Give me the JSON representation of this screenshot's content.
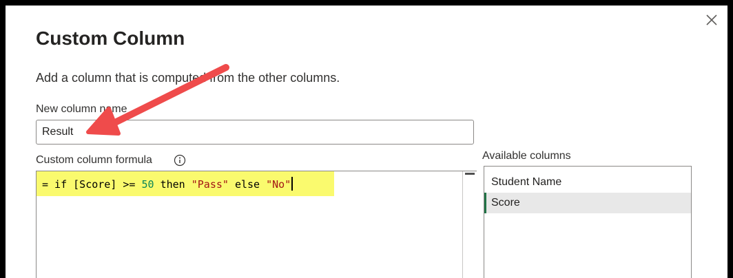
{
  "dialog": {
    "title": "Custom Column",
    "description": "Add a column that is computed from the other columns.",
    "close_icon": "close-icon"
  },
  "new_column_name": {
    "label": "New column name",
    "value": "Result"
  },
  "formula": {
    "label": "Custom column formula",
    "info_icon": "info-icon",
    "tokens": {
      "t0": "= if [Score] >= ",
      "t1": "50",
      "t2": " then ",
      "t3": "\"Pass\"",
      "t4": " else ",
      "t5": "\"No\""
    },
    "highlight_color": "#fafa6e"
  },
  "available_columns": {
    "label": "Available columns",
    "items": [
      "Student Name",
      "Score"
    ],
    "selected": "Score"
  },
  "annotation": {
    "arrow_icon": "red-arrow-icon",
    "arrow_color": "#ef4b4b"
  }
}
